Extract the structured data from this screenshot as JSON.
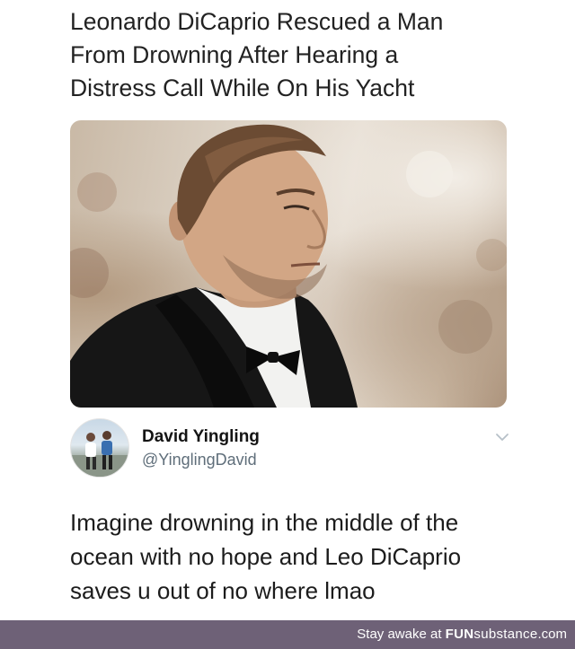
{
  "headline": {
    "lines": [
      "Leonardo DiCaprio Rescued a Man",
      "From Drowning After Hearing a",
      "Distress Call While On His Yacht"
    ]
  },
  "tweet": {
    "display_name": "David Yingling",
    "handle": "@YinglingDavid",
    "menu_icon": "chevron-down-icon",
    "text_lines": [
      "Imagine drowning in the middle of the",
      "ocean with no hope and Leo DiCaprio",
      "saves u out of no where lmao"
    ]
  },
  "footer": {
    "prefix": "Stay awake at ",
    "brand_bold": "FUN",
    "brand_light": "substance",
    "brand_suffix": ".com",
    "background_color": "#6e6177"
  }
}
